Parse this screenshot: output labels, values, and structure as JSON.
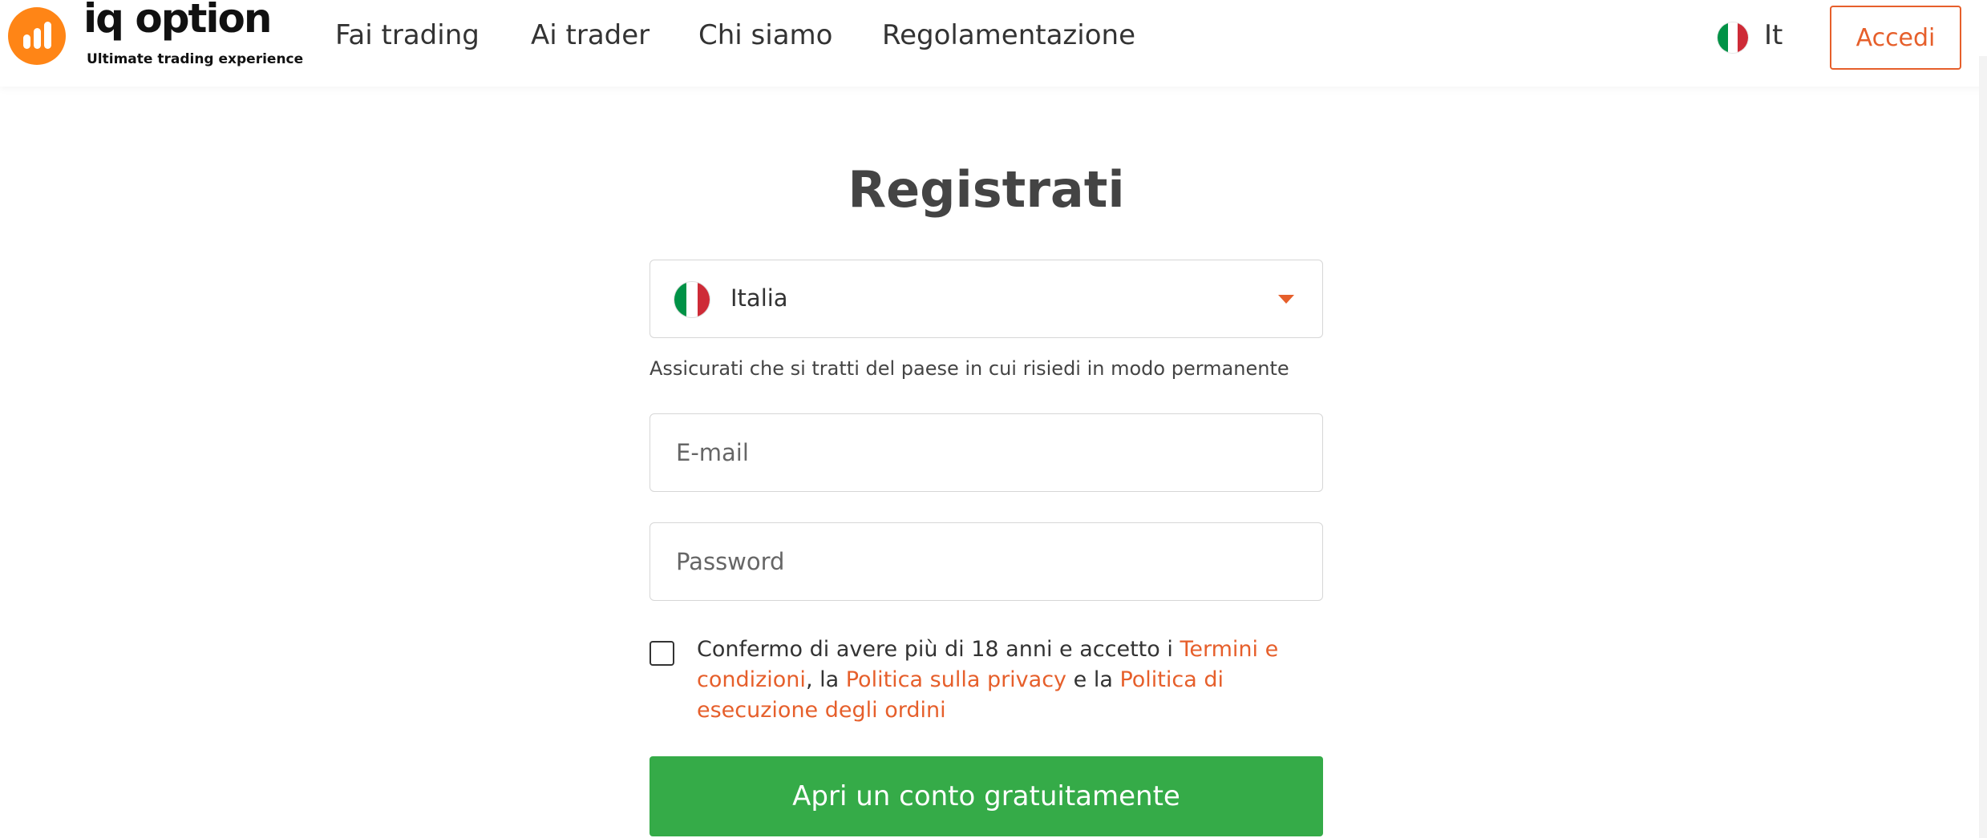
{
  "header": {
    "brand": {
      "name": "iq option",
      "tagline": "Ultimate trading experience",
      "color": "#ff8516"
    },
    "nav": [
      {
        "label": "Fai trading"
      },
      {
        "label": "Ai trader"
      },
      {
        "label": "Chi siamo"
      },
      {
        "label": "Regolamentazione"
      }
    ],
    "language": {
      "code": "It",
      "flag_icon": "italy-flag-icon"
    },
    "login_label": "Accedi"
  },
  "form": {
    "title": "Registrati",
    "country": {
      "value": "Italia",
      "flag_icon": "italy-flag-icon",
      "dropdown_icon": "chevron-down-icon"
    },
    "country_hint": "Assicurati che si tratti del paese in cui risiedi in modo permanente",
    "email": {
      "placeholder": "E-mail",
      "value": ""
    },
    "password": {
      "placeholder": "Password",
      "value": ""
    },
    "consent": {
      "checked": false,
      "text_1": "Confermo di avere più di 18 anni e accetto i ",
      "link_terms": "Termini e condizioni",
      "text_2": ", la ",
      "link_privacy": "Politica sulla privacy",
      "text_3": " e la ",
      "link_execution": "Politica di esecuzione degli ordini"
    },
    "submit_label": "Apri un conto gratuitamente"
  },
  "colors": {
    "accent": "#e65f2b",
    "cta": "#35ab48",
    "text": "#333333",
    "border": "#d6d6d6"
  }
}
